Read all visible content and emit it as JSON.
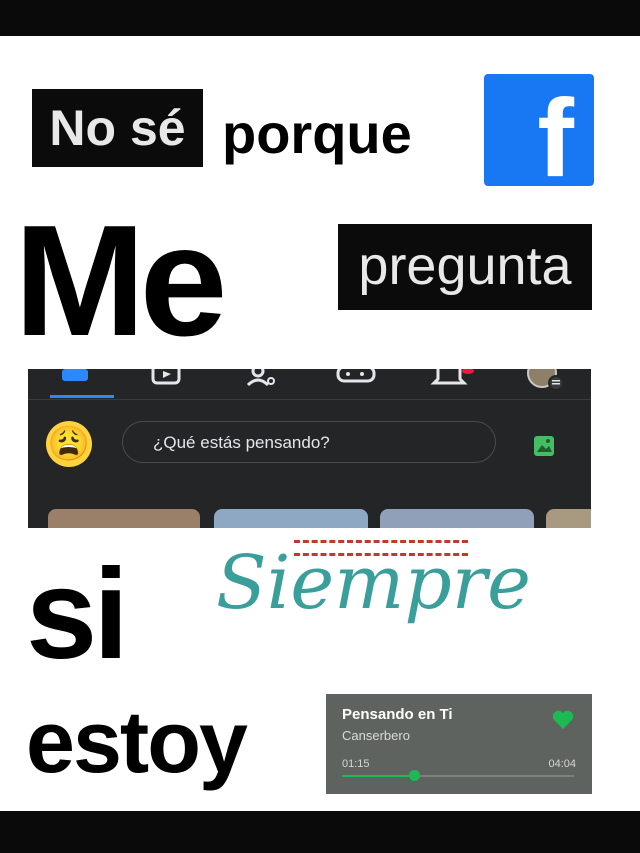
{
  "meme": {
    "line1_boxed": "No sé",
    "line1_plain": "porque",
    "line2_big": "Me",
    "line2_boxed": "pregunta",
    "line3_big": "si",
    "line4_big": "estoy",
    "script_word": "Siempre",
    "script_color": "#3a9e9a"
  },
  "facebook": {
    "logo_letter": "f",
    "brand_color": "#1877f2",
    "status_placeholder": "¿Qué estás pensando?",
    "status_emoji": "😩",
    "nav_icons": [
      "home-icon",
      "video-icon",
      "friends-icon",
      "gaming-icon",
      "bell-icon",
      "profile-avatar-icon"
    ],
    "photo_icon": "photo-icon",
    "panel_color": "#242526"
  },
  "song": {
    "title": "Pensando en Ti",
    "artist": "Canserbero",
    "elapsed": "01:15",
    "duration": "04:04",
    "progress": 0.31,
    "accent": "#1db954",
    "liked": true
  }
}
